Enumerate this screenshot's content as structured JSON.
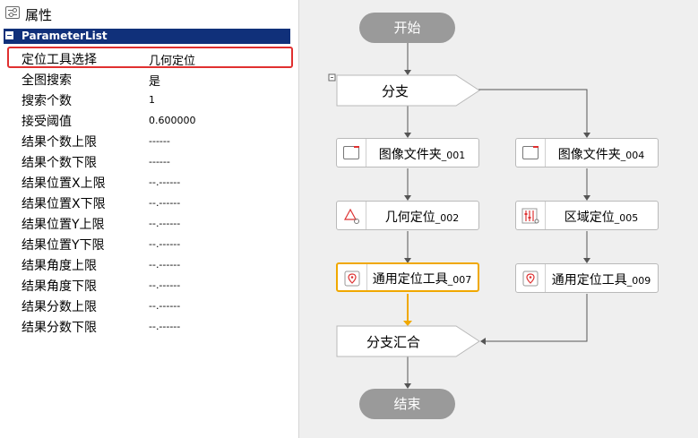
{
  "panel": {
    "title": "属性",
    "group": "ParameterList",
    "properties": [
      {
        "name": "定位工具选择",
        "value": "几何定位"
      },
      {
        "name": "全图搜索",
        "value": "是"
      },
      {
        "name": "搜索个数",
        "value": "1"
      },
      {
        "name": "接受阈值",
        "value": "0.600000"
      },
      {
        "name": "结果个数上限",
        "value": "------"
      },
      {
        "name": "结果个数下限",
        "value": "------"
      },
      {
        "name": "结果位置X上限",
        "value": "--.------"
      },
      {
        "name": "结果位置X下限",
        "value": "--.------"
      },
      {
        "name": "结果位置Y上限",
        "value": "--.------"
      },
      {
        "name": "结果位置Y下限",
        "value": "--.------"
      },
      {
        "name": "结果角度上限",
        "value": "--.------"
      },
      {
        "name": "结果角度下限",
        "value": "--.------"
      },
      {
        "name": "结果分数上限",
        "value": "--.------"
      },
      {
        "name": "结果分数下限",
        "value": "--.------"
      }
    ],
    "highlighted_index": 0
  },
  "flow": {
    "start": "开始",
    "end": "结束",
    "branch": "分支",
    "merge": "分支汇合",
    "left_nodes": [
      {
        "name": "图像文件夹",
        "suffix": "_001",
        "icon": "folder-icon"
      },
      {
        "name": "几何定位",
        "suffix": "_002",
        "icon": "geometric-locate-icon"
      },
      {
        "name": "通用定位工具",
        "suffix": "_007",
        "icon": "location-pin-icon",
        "active": true
      }
    ],
    "right_nodes": [
      {
        "name": "图像文件夹",
        "suffix": "_004",
        "icon": "folder-icon"
      },
      {
        "name": "区域定位",
        "suffix": "_005",
        "icon": "region-locate-icon"
      },
      {
        "name": "通用定位工具",
        "suffix": "_009",
        "icon": "location-pin-icon"
      }
    ],
    "colors": {
      "active_border": "#f0a800",
      "pill": "#9a9a9a",
      "highlight": "#e03030",
      "group_bg": "#10307a"
    }
  }
}
